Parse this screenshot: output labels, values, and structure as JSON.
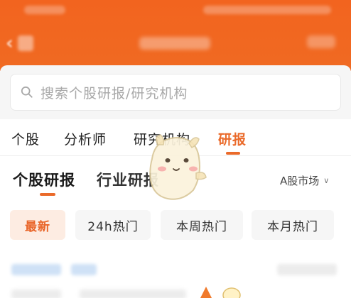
{
  "search": {
    "placeholder": "搜索个股研报/研究机构"
  },
  "tabs": [
    {
      "label": "个股"
    },
    {
      "label": "分析师"
    },
    {
      "label": "研究机构"
    },
    {
      "label": "研报",
      "active": true
    }
  ],
  "subtabs": [
    {
      "label": "个股研报",
      "active": true
    },
    {
      "label": "行业研报"
    }
  ],
  "market": {
    "label": "A股市场",
    "chevron_icon": "chevron-down-icon"
  },
  "filters": [
    {
      "label": "最新",
      "active": true
    },
    {
      "label": "24h热门"
    },
    {
      "label": "本周热门"
    },
    {
      "label": "本月热门"
    }
  ],
  "colors": {
    "header": "#f2641f",
    "accent": "#ea6a2a",
    "chip_active_bg": "#fdece2",
    "chip_bg": "#f6f6f6"
  },
  "icons": {
    "back": "back-arrow-icon",
    "search": "search-icon",
    "mascot": "mascot-sticker-icon"
  }
}
